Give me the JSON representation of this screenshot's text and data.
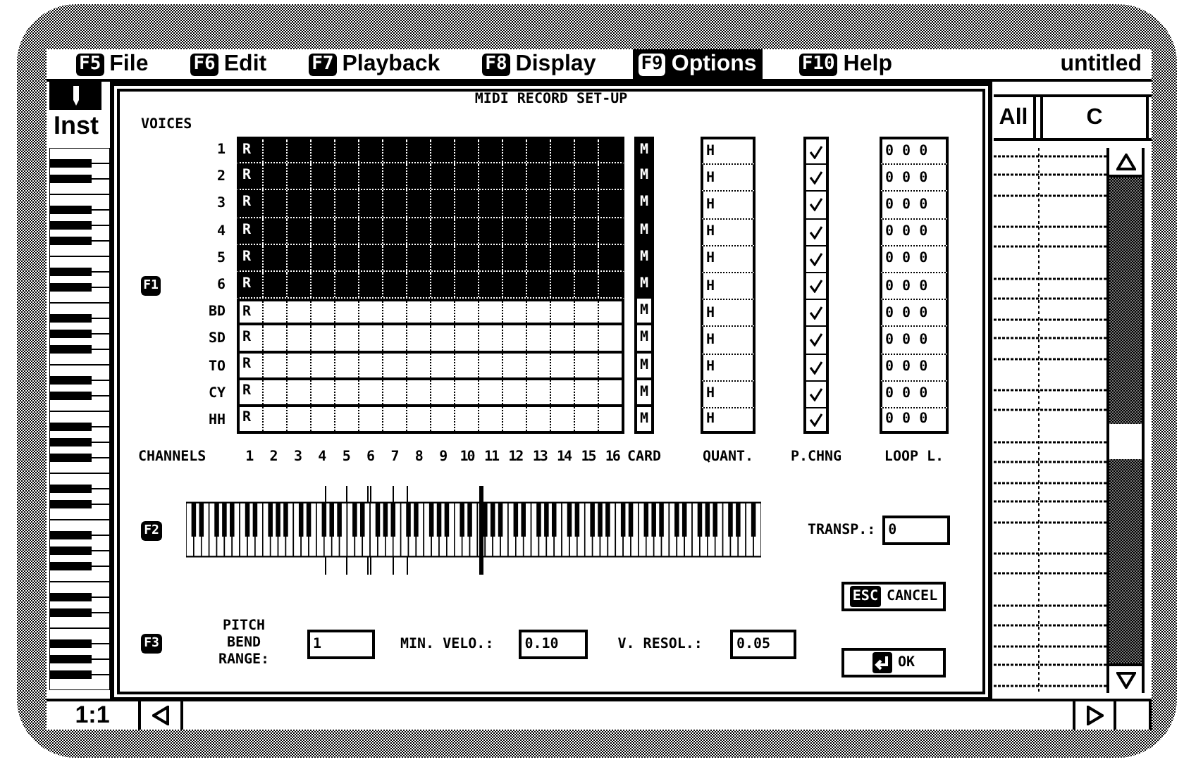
{
  "menu_bar": {
    "items": [
      {
        "key": "F5",
        "label": "File",
        "selected": false
      },
      {
        "key": "F6",
        "label": "Edit",
        "selected": false
      },
      {
        "key": "F7",
        "label": "Playback",
        "selected": false
      },
      {
        "key": "F8",
        "label": "Display",
        "selected": false
      },
      {
        "key": "F9",
        "label": "Options",
        "selected": true
      },
      {
        "key": "F10",
        "label": "Help",
        "selected": false
      }
    ],
    "document_title": "untitled"
  },
  "track_header": {
    "label": "Inst",
    "channel": "All",
    "key": "C"
  },
  "position": "1:1",
  "dialog": {
    "title": "MIDI RECORD SET-UP",
    "voices_label": "VOICES",
    "voices_key": "F1",
    "voices": [
      {
        "name": "1",
        "highlighted": true,
        "marker": "R",
        "card": "M",
        "quant": "H",
        "program_change": true,
        "loop": "0 0 0"
      },
      {
        "name": "2",
        "highlighted": true,
        "marker": "R",
        "card": "M",
        "quant": "H",
        "program_change": true,
        "loop": "0 0 0"
      },
      {
        "name": "3",
        "highlighted": true,
        "marker": "R",
        "card": "M",
        "quant": "H",
        "program_change": true,
        "loop": "0 0 0"
      },
      {
        "name": "4",
        "highlighted": true,
        "marker": "R",
        "card": "M",
        "quant": "H",
        "program_change": true,
        "loop": "0 0 0"
      },
      {
        "name": "5",
        "highlighted": true,
        "marker": "R",
        "card": "M",
        "quant": "H",
        "program_change": true,
        "loop": "0 0 0"
      },
      {
        "name": "6",
        "highlighted": true,
        "marker": "R",
        "card": "M",
        "quant": "H",
        "program_change": true,
        "loop": "0 0 0"
      },
      {
        "name": "BD",
        "highlighted": false,
        "marker": "R",
        "card": "M",
        "quant": "H",
        "program_change": true,
        "loop": "0 0 0"
      },
      {
        "name": "SD",
        "highlighted": false,
        "marker": "R",
        "card": "M",
        "quant": "H",
        "program_change": true,
        "loop": "0 0 0"
      },
      {
        "name": "TO",
        "highlighted": false,
        "marker": "R",
        "card": "M",
        "quant": "H",
        "program_change": true,
        "loop": "0 0 0"
      },
      {
        "name": "CY",
        "highlighted": false,
        "marker": "R",
        "card": "M",
        "quant": "H",
        "program_change": true,
        "loop": "0 0 0"
      },
      {
        "name": "HH",
        "highlighted": false,
        "marker": "R",
        "card": "M",
        "quant": "H",
        "program_change": true,
        "loop": "0 0 0"
      }
    ],
    "columns": {
      "channels": "CHANNELS",
      "channel_numbers": [
        "1",
        "2",
        "3",
        "4",
        "5",
        "6",
        "7",
        "8",
        "9",
        "10",
        "11",
        "12",
        "13",
        "14",
        "15",
        "16"
      ],
      "card": "CARD",
      "quant": "QUANT.",
      "program_change": "P.CHNG",
      "loop": "LOOP L."
    },
    "keyboard_key": "F2",
    "transpose": {
      "label": "TRANSP.:",
      "value": "0"
    },
    "settings_key": "F3",
    "pitch_bend": {
      "label": "PITCH BEND RANGE:",
      "value": "1"
    },
    "min_velocity": {
      "label": "MIN. VELO.:",
      "value": "0.10"
    },
    "velocity_resolution": {
      "label": "V. RESOL.:",
      "value": "0.05"
    },
    "buttons": [
      {
        "kind": "cancel",
        "key": "ESC",
        "label": "CANCEL"
      },
      {
        "kind": "ok",
        "label": "OK"
      }
    ]
  }
}
